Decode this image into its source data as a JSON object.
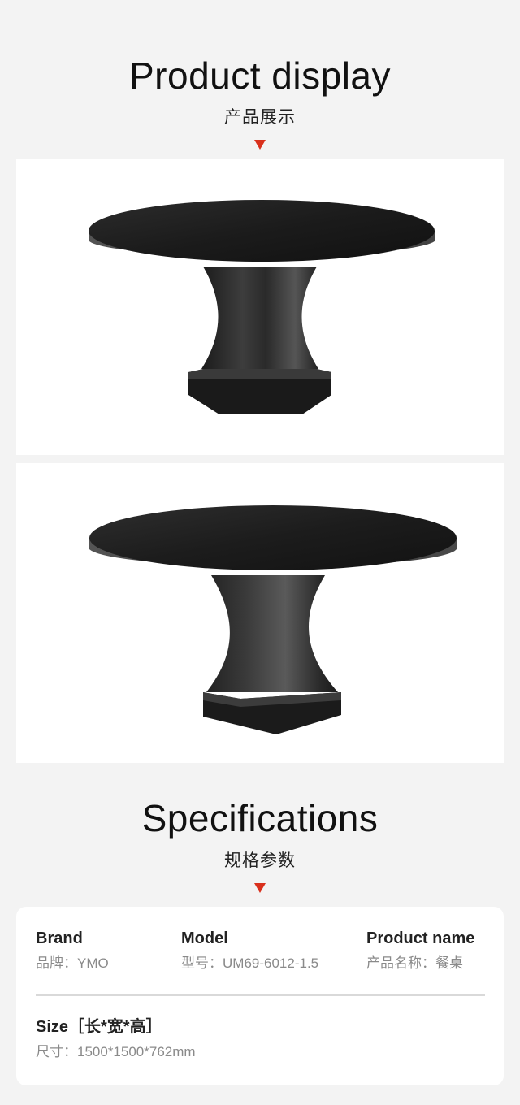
{
  "display": {
    "title": "Product display",
    "subtitle": "产品展示"
  },
  "specifications": {
    "title": "Specifications",
    "subtitle": "规格参数",
    "brand": {
      "label": "Brand",
      "value": "品牌：YMO"
    },
    "model": {
      "label": "Model",
      "value": "型号：UM69-6012-1.5"
    },
    "product_name": {
      "label": "Product name",
      "value": "产品名称：餐桌"
    },
    "size": {
      "label": "Size［长*宽*高］",
      "value": "尺寸：1500*1500*762mm"
    }
  },
  "colors": {
    "background": "#f3f3f3",
    "accent": "#d9301c",
    "panel": "#ffffff"
  }
}
